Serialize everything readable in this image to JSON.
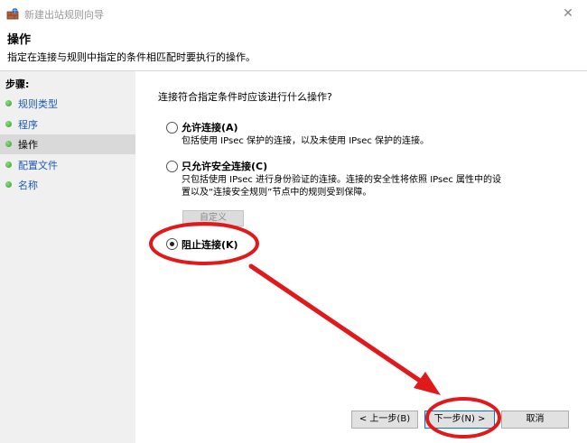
{
  "window": {
    "title": "新建出站规则向导",
    "close_glyph": "✕"
  },
  "header": {
    "title": "操作",
    "description": "指定在连接与规则中指定的条件相匹配时要执行的操作。"
  },
  "sidebar": {
    "heading": "步骤:",
    "items": [
      {
        "label": "规则类型",
        "active": false
      },
      {
        "label": "程序",
        "active": false
      },
      {
        "label": "操作",
        "active": true
      },
      {
        "label": "配置文件",
        "active": false
      },
      {
        "label": "名称",
        "active": false
      }
    ]
  },
  "main": {
    "question": "连接符合指定条件时应该进行什么操作?",
    "options": [
      {
        "label": "允许连接(A)",
        "description": "包括使用 IPsec 保护的连接，以及未使用 IPsec 保护的连接。",
        "selected": false
      },
      {
        "label": "只允许安全连接(C)",
        "description_line1": "只包括使用 IPsec 进行身份验证的连接。连接的安全性将依照 IPsec 属性中的设",
        "description_line2": "置以及“连接安全规则”节点中的规则受到保障。",
        "selected": false
      },
      {
        "label": "阻止连接(K)",
        "selected": true
      }
    ],
    "customize_label": "自定义"
  },
  "footer": {
    "back_label": "< 上一步(B)",
    "next_label": "下一步(N) >",
    "cancel_label": "取消"
  },
  "annotation": {
    "color": "#e0191b",
    "icons": [
      "red-ellipse-highlight",
      "red-arrow"
    ]
  }
}
